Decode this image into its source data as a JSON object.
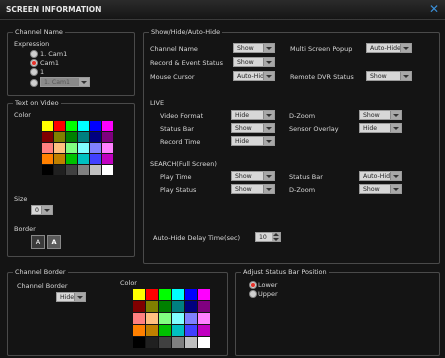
{
  "window": {
    "title": "SCREEN INFORMATION"
  },
  "channel_name": {
    "legend": "Channel Name",
    "expression_label": "Expression",
    "options": [
      {
        "label": "1. Cam1",
        "selected": false
      },
      {
        "label": "Cam1",
        "selected": true
      },
      {
        "label": "1",
        "selected": false
      }
    ],
    "dropdown": {
      "value": "1. Cam1"
    }
  },
  "text_on_video": {
    "legend": "Text on Video",
    "color_label": "Color",
    "size_label": "Size",
    "size_value": "0",
    "border_label": "Border",
    "border_plain": "A",
    "border_outlined": "A"
  },
  "show_hide": {
    "legend": "Show/Hide/Auto-Hide",
    "rows": [
      {
        "label": "Channel Name",
        "value": "Show"
      },
      {
        "label": "Record & Event Status",
        "value": "Show"
      },
      {
        "label": "Mouse Cursor",
        "value": "Auto-Hide"
      }
    ],
    "right_rows": [
      {
        "label": "Multi Screen Popup",
        "value": "Auto-Hide"
      },
      {
        "label": "Remote DVR Status",
        "value": "Show"
      }
    ],
    "live": {
      "header": "LIVE",
      "left": [
        {
          "label": "Video Format",
          "value": "Hide"
        },
        {
          "label": "Status Bar",
          "value": "Show"
        },
        {
          "label": "Record Time",
          "value": "Hide"
        }
      ],
      "right": [
        {
          "label": "D-Zoom",
          "value": "Show"
        },
        {
          "label": "Sensor Overlay",
          "value": "Hide"
        }
      ]
    },
    "search": {
      "header": "SEARCH(Full Screen)",
      "left": [
        {
          "label": "Play Time",
          "value": "Show"
        },
        {
          "label": "Play Status",
          "value": "Show"
        }
      ],
      "right": [
        {
          "label": "Status Bar",
          "value": "Auto-Hide"
        },
        {
          "label": "D-Zoom",
          "value": "Show"
        }
      ]
    },
    "delay_label": "Auto-Hide Delay Time(sec)",
    "delay_value": "10"
  },
  "channel_border": {
    "legend": "Channel Border",
    "label": "Channel Border",
    "value": "Hide",
    "color_label": "Color"
  },
  "status_bar_position": {
    "legend": "Adjust Status Bar Position",
    "options": [
      {
        "label": "Lower",
        "selected": true
      },
      {
        "label": "Upper",
        "selected": false
      }
    ]
  },
  "palette": [
    "#ffff00",
    "#ff0000",
    "#00ff00",
    "#00ffff",
    "#0000ff",
    "#ff00ff",
    "#800000",
    "#808000",
    "#008000",
    "#008080",
    "#000080",
    "#800080",
    "#ff8080",
    "#ffc080",
    "#80ff80",
    "#80ffff",
    "#8080ff",
    "#ff80ff",
    "#ff8000",
    "#c08000",
    "#00c000",
    "#00c0c0",
    "#4040ff",
    "#c000c0",
    "#000000",
    "#202020",
    "#404040",
    "#808080",
    "#c0c0c0",
    "#ffffff"
  ]
}
